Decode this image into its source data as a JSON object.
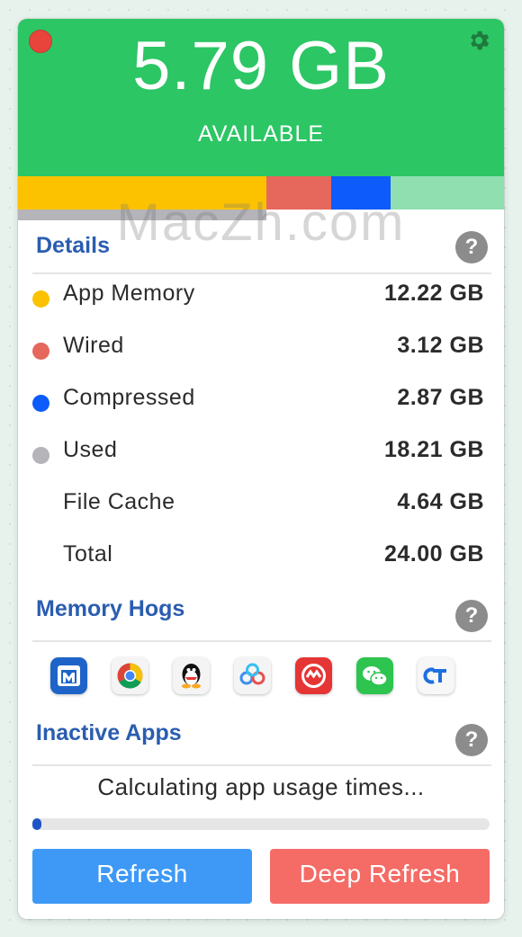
{
  "header": {
    "available_value": "5.79 GB",
    "available_label": "AVAILABLE",
    "bg_color": "#2cc664"
  },
  "memory_bar": {
    "segments": [
      {
        "name": "App Memory",
        "color": "#fcc200"
      },
      {
        "name": "Wired",
        "color": "#e6675c"
      },
      {
        "name": "Compressed",
        "color": "#0d5bfa"
      },
      {
        "name": "Available",
        "color": "#8fdfb0"
      }
    ],
    "used_color": "#b4b4b9"
  },
  "watermark": "MacZh.com",
  "details": {
    "title": "Details",
    "help": "?",
    "rows": [
      {
        "label": "App Memory",
        "value": "12.22 GB",
        "dot_color": "#fcc200"
      },
      {
        "label": "Wired",
        "value": "3.12 GB",
        "dot_color": "#e6675c"
      },
      {
        "label": "Compressed",
        "value": "2.87 GB",
        "dot_color": "#0d5bfa"
      },
      {
        "label": "Used",
        "value": "18.21 GB",
        "dot_color": "#b4b4b9"
      },
      {
        "label": "File Cache",
        "value": "4.64 GB"
      },
      {
        "label": "Total",
        "value": "24.00 GB"
      }
    ]
  },
  "memory_hogs": {
    "title": "Memory Hogs",
    "help": "?",
    "apps": [
      {
        "icon": "maxthon-browser-icon"
      },
      {
        "icon": "chrome-icon"
      },
      {
        "icon": "qq-icon"
      },
      {
        "icon": "baidu-netdisk-icon"
      },
      {
        "icon": "red-app-icon"
      },
      {
        "icon": "wechat-icon"
      },
      {
        "icon": "ct-app-icon"
      }
    ]
  },
  "inactive_apps": {
    "title": "Inactive Apps",
    "help": "?",
    "status": "Calculating app usage times...",
    "progress": 0.02
  },
  "buttons": {
    "refresh": "Refresh",
    "deep_refresh": "Deep Refresh"
  }
}
